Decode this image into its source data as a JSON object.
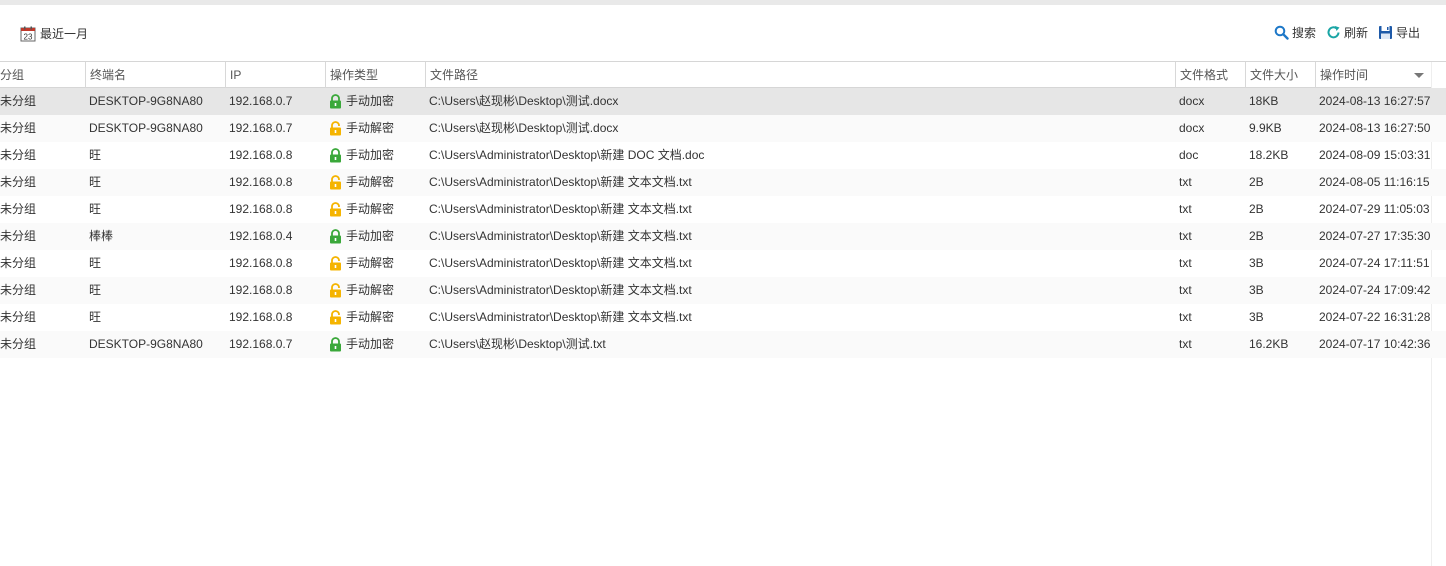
{
  "toolbar": {
    "date_filter_label": "最近一月",
    "date_icon_text": "23",
    "search_label": "搜索",
    "refresh_label": "刷新",
    "export_label": "导出"
  },
  "columns": [
    "分组",
    "终端名",
    "IP",
    "操作类型",
    "文件路径",
    "文件格式",
    "文件大小",
    "操作时间"
  ],
  "colors": {
    "encrypt_lock": "#3aa83a",
    "decrypt_lock": "#f5b400",
    "selected_row": "#e6e6e6",
    "icon_blue": "#1e78c8",
    "refresh_teal": "#1aa5a5"
  },
  "rows": [
    {
      "group": "未分组",
      "terminal": "DESKTOP-9G8NA80",
      "ip": "192.168.0.7",
      "op_type": "手动加密",
      "op_kind": "encrypt",
      "path": "C:\\Users\\赵现彬\\Desktop\\测试.docx",
      "format": "docx",
      "size": "18KB",
      "time": "2024-08-13 16:27:57"
    },
    {
      "group": "未分组",
      "terminal": "DESKTOP-9G8NA80",
      "ip": "192.168.0.7",
      "op_type": "手动解密",
      "op_kind": "decrypt",
      "path": "C:\\Users\\赵现彬\\Desktop\\测试.docx",
      "format": "docx",
      "size": "9.9KB",
      "time": "2024-08-13 16:27:50"
    },
    {
      "group": "未分组",
      "terminal": "旺",
      "ip": "192.168.0.8",
      "op_type": "手动加密",
      "op_kind": "encrypt",
      "path": "C:\\Users\\Administrator\\Desktop\\新建 DOC 文档.doc",
      "format": "doc",
      "size": "18.2KB",
      "time": "2024-08-09 15:03:31"
    },
    {
      "group": "未分组",
      "terminal": "旺",
      "ip": "192.168.0.8",
      "op_type": "手动解密",
      "op_kind": "decrypt",
      "path": "C:\\Users\\Administrator\\Desktop\\新建 文本文档.txt",
      "format": "txt",
      "size": "2B",
      "time": "2024-08-05 11:16:15"
    },
    {
      "group": "未分组",
      "terminal": "旺",
      "ip": "192.168.0.8",
      "op_type": "手动解密",
      "op_kind": "decrypt",
      "path": "C:\\Users\\Administrator\\Desktop\\新建 文本文档.txt",
      "format": "txt",
      "size": "2B",
      "time": "2024-07-29 11:05:03"
    },
    {
      "group": "未分组",
      "terminal": "棒棒",
      "ip": "192.168.0.4",
      "op_type": "手动加密",
      "op_kind": "encrypt",
      "path": "C:\\Users\\Administrator\\Desktop\\新建 文本文档.txt",
      "format": "txt",
      "size": "2B",
      "time": "2024-07-27 17:35:30"
    },
    {
      "group": "未分组",
      "terminal": "旺",
      "ip": "192.168.0.8",
      "op_type": "手动解密",
      "op_kind": "decrypt",
      "path": "C:\\Users\\Administrator\\Desktop\\新建 文本文档.txt",
      "format": "txt",
      "size": "3B",
      "time": "2024-07-24 17:11:51"
    },
    {
      "group": "未分组",
      "terminal": "旺",
      "ip": "192.168.0.8",
      "op_type": "手动解密",
      "op_kind": "decrypt",
      "path": "C:\\Users\\Administrator\\Desktop\\新建 文本文档.txt",
      "format": "txt",
      "size": "3B",
      "time": "2024-07-24 17:09:42"
    },
    {
      "group": "未分组",
      "terminal": "旺",
      "ip": "192.168.0.8",
      "op_type": "手动解密",
      "op_kind": "decrypt",
      "path": "C:\\Users\\Administrator\\Desktop\\新建 文本文档.txt",
      "format": "txt",
      "size": "3B",
      "time": "2024-07-22 16:31:28"
    },
    {
      "group": "未分组",
      "terminal": "DESKTOP-9G8NA80",
      "ip": "192.168.0.7",
      "op_type": "手动加密",
      "op_kind": "encrypt",
      "path": "C:\\Users\\赵现彬\\Desktop\\测试.txt",
      "format": "txt",
      "size": "16.2KB",
      "time": "2024-07-17 10:42:36"
    }
  ]
}
